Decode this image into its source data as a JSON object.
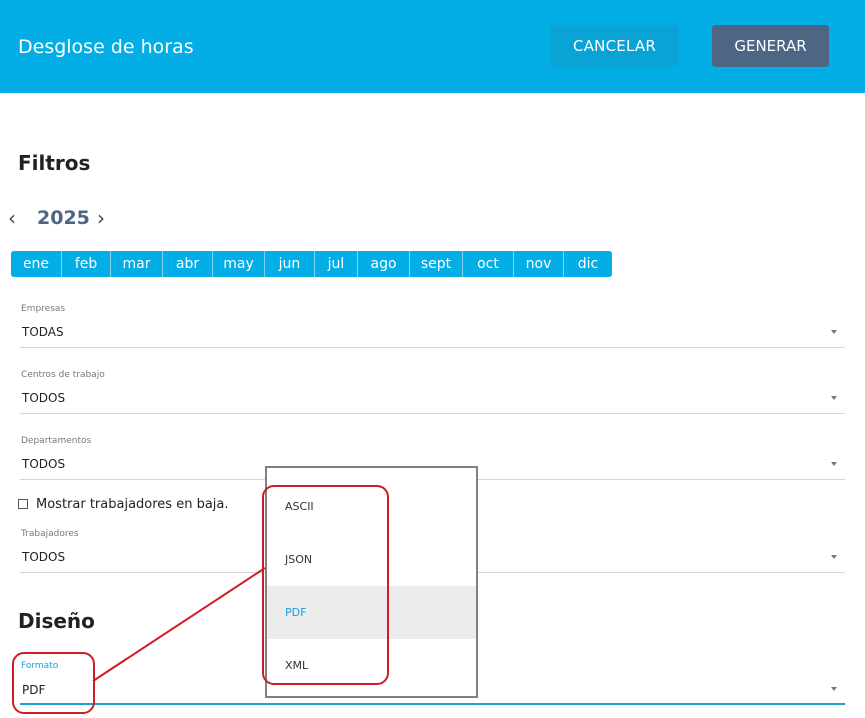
{
  "header": {
    "title": "Desglose de horas",
    "cancel_label": "CANCELAR",
    "generate_label": "GENERAR"
  },
  "filters": {
    "title": "Filtros",
    "year": "2025",
    "months": [
      "ene",
      "feb",
      "mar",
      "abr",
      "may",
      "jun",
      "jul",
      "ago",
      "sept",
      "oct",
      "nov",
      "dic"
    ],
    "fields": [
      {
        "label": "Empresas",
        "value": "TODAS"
      },
      {
        "label": "Centros de trabajo",
        "value": "TODOS"
      },
      {
        "label": "Departamentos",
        "value": "TODOS"
      }
    ],
    "show_inactive_label": "Mostrar trabajadores en baja.",
    "workers": {
      "label": "Trabajadores",
      "value": "TODOS"
    }
  },
  "design": {
    "title": "Diseño",
    "format": {
      "label": "Formato",
      "value": "PDF"
    }
  },
  "format_dropdown": {
    "options": [
      "ASCII",
      "JSON",
      "PDF",
      "XML"
    ],
    "selected": "PDF"
  },
  "colors": {
    "header_bg": "#03ade6",
    "generate_bg": "#4d6684",
    "accent": "#1e9fd8",
    "annotation": "#d01c24"
  }
}
